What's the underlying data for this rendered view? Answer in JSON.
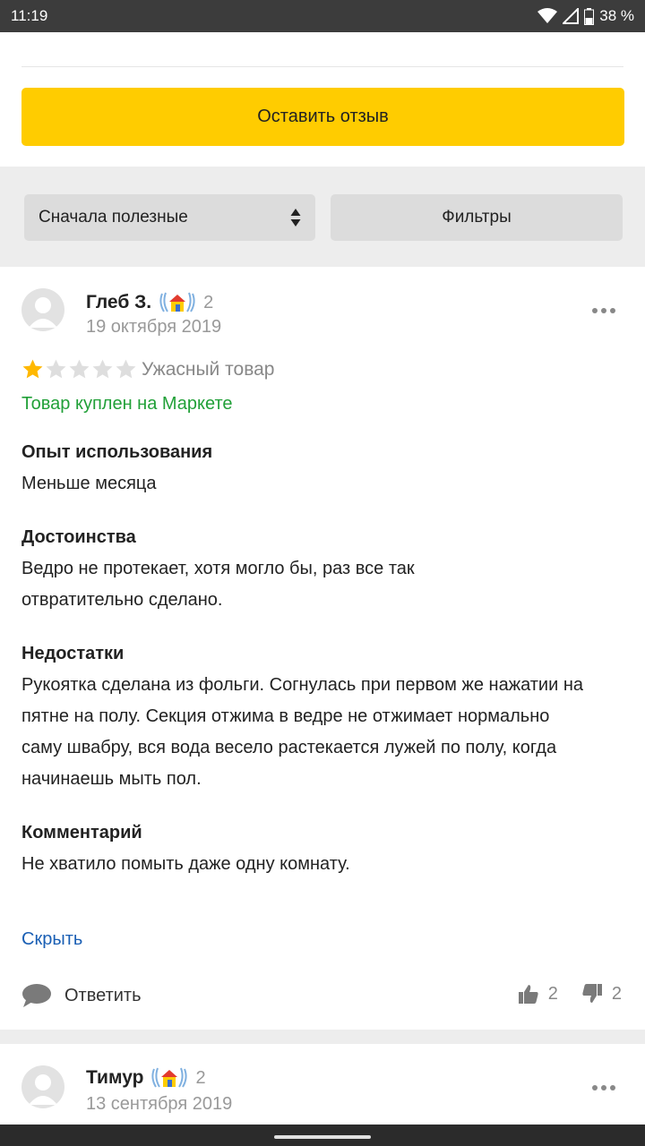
{
  "status_bar": {
    "time": "11:19",
    "battery": "38 %"
  },
  "actions": {
    "write_review": "Оставить отзыв"
  },
  "controls": {
    "sort_label": "Сначала полезные",
    "filters_label": "Фильтры"
  },
  "reviews": [
    {
      "author": "Глеб З.",
      "badge_count": "2",
      "date": "19 октября 2019",
      "rating": 1,
      "rating_max": 5,
      "rating_text": "Ужасный товар",
      "purchase_note": "Товар куплен на Маркете",
      "sections": [
        {
          "title": "Опыт использования",
          "body": "Меньше месяца"
        },
        {
          "title": "Достоинства",
          "body": "Ведро не протекает, хотя могло бы, раз все так отвратительно сделано."
        },
        {
          "title": "Недостатки",
          "body": "Рукоятка сделана из фольги. Согнулась при первом же нажатии на пятне на полу. Секция отжима в ведре не отжимает нормально саму швабру, вся вода весело растекается лужей по полу, когда начинаешь мыть пол."
        },
        {
          "title": "Комментарий",
          "body": "Не хватило помыть даже одну комнату."
        }
      ],
      "hide_label": "Скрыть",
      "reply_label": "Ответить",
      "likes": "2",
      "dislikes": "2"
    },
    {
      "author": "Тимур",
      "badge_count": "2",
      "date": "13 сентября 2019"
    }
  ],
  "colors": {
    "accent": "#ffcc00",
    "purchase_green": "#21a038",
    "link_blue": "#1a5fb4",
    "star_filled": "#ffb800",
    "star_empty": "#dedede"
  },
  "icons": [
    "wifi-icon",
    "signal-icon",
    "battery-icon",
    "sort-arrows-icon",
    "avatar-placeholder-icon",
    "achievement-badge-icon",
    "more-icon",
    "star-icon",
    "comment-icon",
    "thumbs-up-icon",
    "thumbs-down-icon"
  ]
}
